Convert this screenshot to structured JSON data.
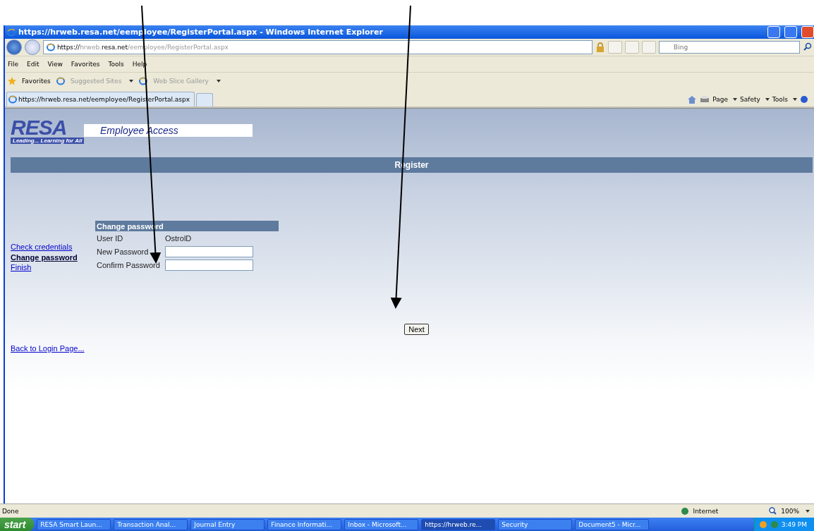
{
  "window": {
    "title": "https://hrweb.resa.net/eemployee/RegisterPortal.aspx - Windows Internet Explorer"
  },
  "address_bar": {
    "url_scheme": "https://",
    "url_host_dim": "hrweb.",
    "url_host": "resa.net",
    "url_path": "/eemployee/RegisterPortal.aspx"
  },
  "search": {
    "placeholder": "Bing"
  },
  "menu": [
    "File",
    "Edit",
    "View",
    "Favorites",
    "Tools",
    "Help"
  ],
  "favorites_bar": {
    "favorites": "Favorites",
    "links": [
      {
        "label": "Suggested Sites"
      },
      {
        "label": "Web Slice Gallery"
      }
    ]
  },
  "tab": {
    "title": "https://hrweb.resa.net/eemployee/RegisterPortal.aspx"
  },
  "command_bar": [
    "Page",
    "Safety",
    "Tools"
  ],
  "page": {
    "logo_text": "RESA",
    "logo_tagline": "Leading... Learning for All",
    "banner": "Employee Access",
    "header": "Register",
    "steps": [
      {
        "label": "Check credentials",
        "selected": false
      },
      {
        "label": "Change password",
        "selected": true
      },
      {
        "label": "Finish",
        "selected": false
      }
    ],
    "section_title": "Change password",
    "fields": [
      {
        "kind": "text",
        "label": "User ID",
        "value": "OstrolD"
      },
      {
        "kind": "input",
        "label": "New Password"
      },
      {
        "kind": "input",
        "label": "Confirm Password"
      }
    ],
    "next_button": "Next",
    "back_link": "Back to Login Page..."
  },
  "status_bar": {
    "status": "Done",
    "zone": "Internet",
    "zoom": "100%"
  },
  "taskbar": {
    "start": "start",
    "items": [
      {
        "label": "RESA Smart Laun...",
        "selected": false
      },
      {
        "label": "Transaction Anal...",
        "selected": false
      },
      {
        "label": "Journal Entry",
        "selected": false
      },
      {
        "label": "Finance Informati...",
        "selected": false
      },
      {
        "label": "Inbox - Microsoft...",
        "selected": false
      },
      {
        "label": "https://hrweb.re...",
        "selected": true
      },
      {
        "label": "Security",
        "selected": false
      },
      {
        "label": "Document5 - Micr...",
        "selected": false
      }
    ],
    "clock": "3:49 PM"
  }
}
